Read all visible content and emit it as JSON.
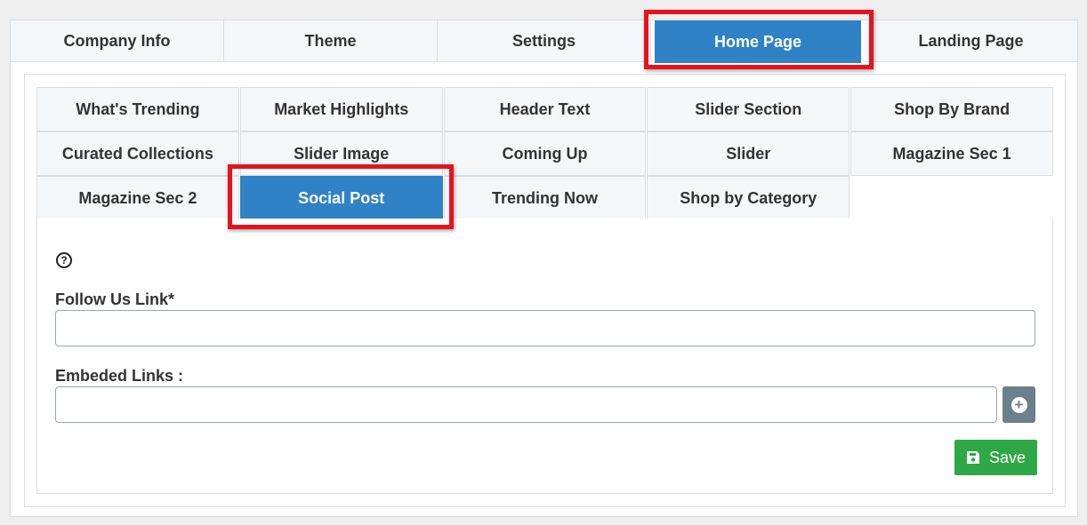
{
  "top_tabs": [
    {
      "label": "Company Info"
    },
    {
      "label": "Theme"
    },
    {
      "label": "Settings"
    },
    {
      "label": "Home Page",
      "active": true
    },
    {
      "label": "Landing Page"
    }
  ],
  "sub_tabs": {
    "row1": [
      "What's Trending",
      "Market Highlights",
      "Header Text",
      "Slider Section",
      "Shop By Brand"
    ],
    "row2": [
      "Curated Collections",
      "Slider Image",
      "Coming Up",
      "Slider",
      "Magazine Sec 1"
    ],
    "row3": [
      "Magazine Sec 2",
      "Social Post",
      "Trending Now",
      "Shop by Category"
    ]
  },
  "active_sub_tab": "Social Post",
  "form": {
    "help_icon": "question-circle-icon",
    "follow_label": "Follow Us Link*",
    "follow_value": "",
    "embed_label": "Embeded Links :",
    "embed_value": "",
    "add_icon": "plus-circle-icon",
    "save_label": "Save",
    "save_icon": "floppy-disk-icon"
  },
  "colors": {
    "active_tab": "#2f82c5",
    "save_button": "#2ea845",
    "highlight": "#e8121c"
  }
}
